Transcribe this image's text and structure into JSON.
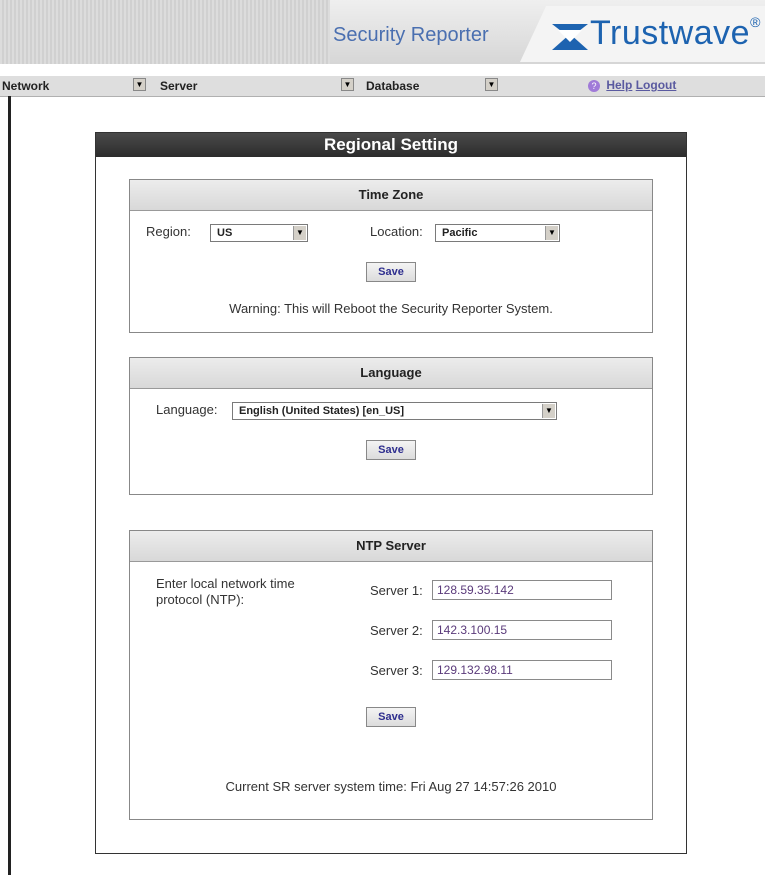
{
  "header": {
    "product_title": "Security Reporter",
    "logo_text": "Trustwave",
    "logo_mark": "®"
  },
  "nav": {
    "menus": [
      {
        "label": "Network"
      },
      {
        "label": "Server"
      },
      {
        "label": "Database"
      }
    ],
    "help_label": "Help",
    "logout_label": "Logout"
  },
  "page": {
    "title": "Regional Setting"
  },
  "time_zone": {
    "header": "Time Zone",
    "region_label": "Region:",
    "region_value": "US",
    "location_label": "Location:",
    "location_value": "Pacific",
    "save_label": "Save",
    "warning": "Warning: This will Reboot the Security Reporter System."
  },
  "language": {
    "header": "Language",
    "label": "Language:",
    "value": "English (United States) [en_US]",
    "save_label": "Save"
  },
  "ntp": {
    "header": "NTP Server",
    "intro_line1": "Enter local network time",
    "intro_line2": "protocol (NTP):",
    "servers": [
      {
        "label": "Server 1:",
        "value": "128.59.35.142"
      },
      {
        "label": "Server 2:",
        "value": "142.3.100.15"
      },
      {
        "label": "Server 3:",
        "value": "129.132.98.11"
      }
    ],
    "save_label": "Save",
    "current_time": "Current SR server system time: Fri Aug 27 14:57:26 2010"
  },
  "colors": {
    "brand_blue": "#1d63b0",
    "title_blue": "#4a6fb0",
    "panel_title_bg": "#3a3a3a",
    "button_text": "#2e2e8e",
    "input_text": "#5a3a7a"
  }
}
